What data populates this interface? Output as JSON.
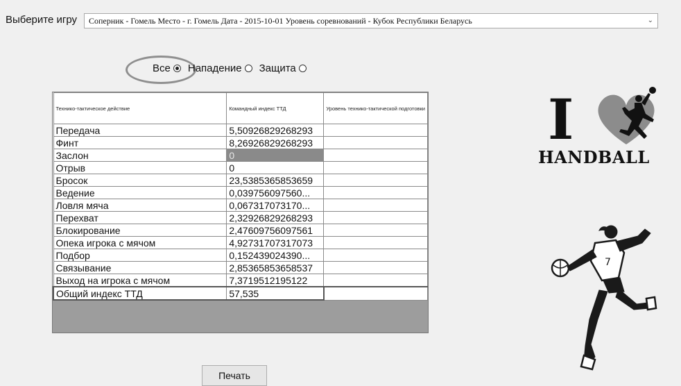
{
  "game_selector": {
    "label": "Выберите игру",
    "value": "Соперник - Гомель Место - г. Гомель Дата - 2015-10-01 Уровень соревнований - Кубок Республики Беларусь"
  },
  "filter": {
    "options": [
      {
        "label": "Все",
        "checked": true
      },
      {
        "label": "Нападение",
        "checked": false
      },
      {
        "label": "Защита",
        "checked": false
      }
    ]
  },
  "grid": {
    "headers": [
      "Технико-тактическое действие",
      "Командный индекс ТТД",
      "Уровень технико-тактической подготовки"
    ],
    "rows": [
      {
        "action": "Передача",
        "index": "5,50926829268293",
        "level": ""
      },
      {
        "action": "Финт",
        "index": "8,26926829268293",
        "level": ""
      },
      {
        "action": "Заслон",
        "index": "0",
        "level": ""
      },
      {
        "action": "Отрыв",
        "index": "0",
        "level": ""
      },
      {
        "action": "Бросок",
        "index": "23,5385365853659",
        "level": ""
      },
      {
        "action": "Ведение",
        "index": "0,039756097560...",
        "level": ""
      },
      {
        "action": "Ловля мяча",
        "index": "0,067317073170...",
        "level": ""
      },
      {
        "action": "Перехват",
        "index": "2,32926829268293",
        "level": ""
      },
      {
        "action": "Блокирование",
        "index": "2,47609756097561",
        "level": ""
      },
      {
        "action": "Опека игрока с мячом",
        "index": "4,92731707317073",
        "level": ""
      },
      {
        "action": "Подбор",
        "index": "0,152439024390...",
        "level": ""
      },
      {
        "action": "Связывание",
        "index": "2,85365853658537",
        "level": ""
      },
      {
        "action": "Выход на игрока с мячом",
        "index": "7,3719512195122",
        "level": ""
      }
    ],
    "total": {
      "label": "Общий индекс ТТД",
      "value": "57,535"
    }
  },
  "print_button": {
    "label": "Печать"
  },
  "logo": {
    "letter": "I",
    "text": "HANDBALL"
  },
  "colors": {
    "heart": "#8c8c8c",
    "selected_cell": "#8a8a8a",
    "grid_bg": "#9d9d9d"
  }
}
